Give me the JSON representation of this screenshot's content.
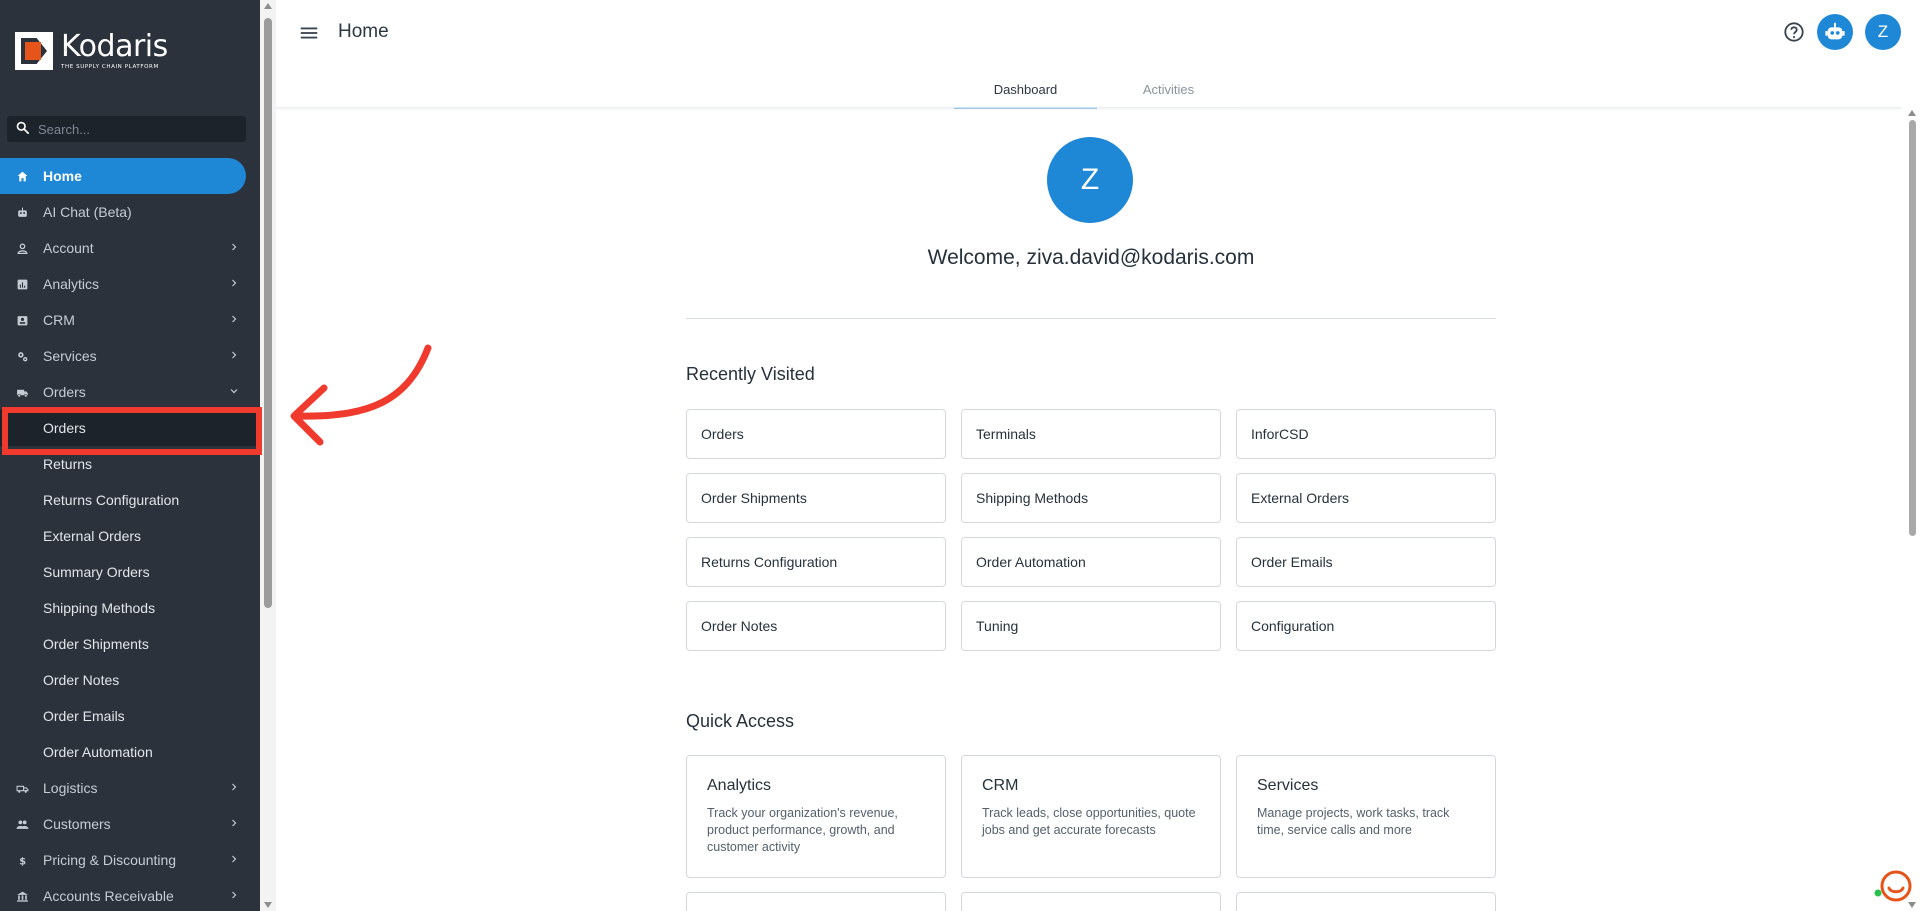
{
  "app": {
    "brand_name": "Kodaris",
    "brand_tagline": "THE SUPPLY CHAIN PLATFORM",
    "brand_color": "#e5551b",
    "accent_color": "#1e88d6",
    "highlight_color": "#f03a2e"
  },
  "sidebar": {
    "search_placeholder": "Search...",
    "items": [
      {
        "label": "Home",
        "icon": "home-icon",
        "active": true
      },
      {
        "label": "AI Chat (Beta)",
        "icon": "robot-icon"
      },
      {
        "label": "Account",
        "icon": "person-icon",
        "expandable": true
      },
      {
        "label": "Analytics",
        "icon": "chart-icon",
        "expandable": true
      },
      {
        "label": "CRM",
        "icon": "contact-card-icon",
        "expandable": true
      },
      {
        "label": "Services",
        "icon": "gears-icon",
        "expandable": true
      },
      {
        "label": "Orders",
        "icon": "truck-icon",
        "expanded": true
      }
    ],
    "orders_sub": [
      {
        "label": "Orders",
        "current": true
      },
      {
        "label": "Returns"
      },
      {
        "label": "Returns Configuration"
      },
      {
        "label": "External Orders"
      },
      {
        "label": "Summary Orders"
      },
      {
        "label": "Shipping Methods"
      },
      {
        "label": "Order Shipments"
      },
      {
        "label": "Order Notes"
      },
      {
        "label": "Order Emails"
      },
      {
        "label": "Order Automation"
      }
    ],
    "items_after": [
      {
        "label": "Logistics",
        "icon": "delivery-truck-icon",
        "expandable": true
      },
      {
        "label": "Customers",
        "icon": "people-icon",
        "expandable": true
      },
      {
        "label": "Pricing & Discounting",
        "icon": "dollar-icon",
        "expandable": true
      },
      {
        "label": "Accounts Receivable",
        "icon": "bank-icon",
        "expandable": true
      }
    ]
  },
  "header": {
    "title": "Home",
    "avatar_initial": "Z"
  },
  "tabs": [
    {
      "label": "Dashboard",
      "active": true
    },
    {
      "label": "Activities"
    }
  ],
  "dashboard": {
    "avatar_initial": "Z",
    "welcome": "Welcome, ziva.david@kodaris.com",
    "recent_title": "Recently Visited",
    "recent": [
      "Orders",
      "Terminals",
      "InforCSD",
      "Order Shipments",
      "Shipping Methods",
      "External Orders",
      "Returns Configuration",
      "Order Automation",
      "Order Emails",
      "Order Notes",
      "Tuning",
      "Configuration"
    ],
    "quick_title": "Quick Access",
    "quick": [
      {
        "title": "Analytics",
        "desc": "Track your organization's revenue, product performance, growth, and customer activity"
      },
      {
        "title": "CRM",
        "desc": "Track leads, close opportunities, quote jobs and get accurate forecasts"
      },
      {
        "title": "Services",
        "desc": "Manage projects, work tasks, track time, service calls and more"
      }
    ]
  }
}
